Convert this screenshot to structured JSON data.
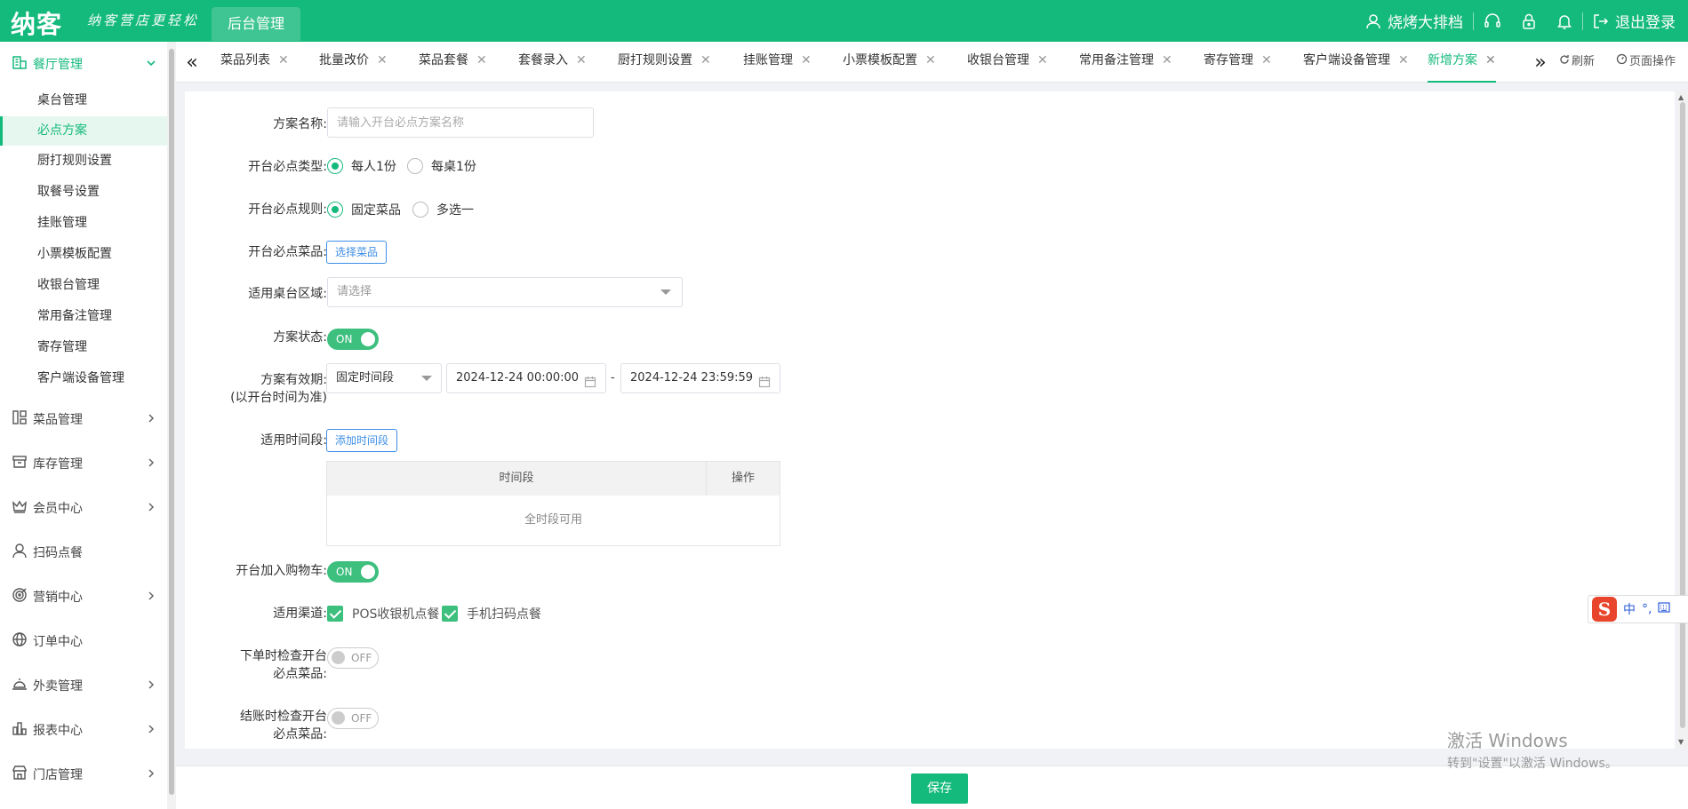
{
  "header": {
    "logo": "纳客",
    "slogan": "纳客营店更轻松",
    "nav_tab": "后台管理",
    "store_name": "烧烤大排档",
    "logout": "退出登录"
  },
  "sidebar": {
    "groups": [
      {
        "label": "餐厅管理",
        "icon": "restaurant-icon",
        "expanded": true
      },
      {
        "label": "菜品管理",
        "icon": "dish-icon"
      },
      {
        "label": "库存管理",
        "icon": "inventory-icon"
      },
      {
        "label": "会员中心",
        "icon": "crown-icon"
      },
      {
        "label": "扫码点餐",
        "icon": "user-icon"
      },
      {
        "label": "营销中心",
        "icon": "target-icon"
      },
      {
        "label": "订单中心",
        "icon": "globe-icon"
      },
      {
        "label": "外卖管理",
        "icon": "bell-service-icon"
      },
      {
        "label": "报表中心",
        "icon": "bar-chart-icon"
      },
      {
        "label": "门店管理",
        "icon": "store-icon"
      }
    ],
    "items": [
      "桌台管理",
      "必点方案",
      "厨打规则设置",
      "取餐号设置",
      "挂账管理",
      "小票模板配置",
      "收银台管理",
      "常用备注管理",
      "寄存管理",
      "客户端设备管理"
    ],
    "active_item": "必点方案"
  },
  "tabs": {
    "items": [
      "菜品列表",
      "批量改价",
      "菜品套餐",
      "套餐录入",
      "厨打规则设置",
      "挂账管理",
      "小票模板配置",
      "收银台管理",
      "常用备注管理",
      "寄存管理",
      "客户端设备管理",
      "新增方案"
    ],
    "active": "新增方案",
    "refresh": "刷新",
    "page_ops": "页面操作"
  },
  "form": {
    "name_label": "方案名称:",
    "name_placeholder": "请输入开台必点方案名称",
    "type_label": "开台必点类型:",
    "type_options": [
      "每人1份",
      "每桌1份"
    ],
    "rule_label": "开台必点规则:",
    "rule_options": [
      "固定菜品",
      "多选一"
    ],
    "dish_label": "开台必点菜品:",
    "select_dish_btn": "选择菜品",
    "area_label": "适用桌台区域:",
    "area_placeholder": "请选择",
    "status_label": "方案状态:",
    "status_value": "ON",
    "validity_label_1": "方案有效期:",
    "validity_label_2": "(以开台时间为准)",
    "validity_mode": "固定时间段",
    "start_time": "2024-12-24 00:00:00",
    "end_time": "2024-12-24 23:59:59",
    "date_sep": "-",
    "period_label": "适用时间段:",
    "add_period_btn": "添加时间段",
    "table_headers": [
      "时间段",
      "操作"
    ],
    "table_empty": "全时段可用",
    "cart_label": "开台加入购物车:",
    "cart_value": "ON",
    "channel_label": "适用渠道:",
    "channels": [
      "POS收银机点餐",
      "手机扫码点餐"
    ],
    "check_order_label_1": "下单时检查开台",
    "check_order_label_2": "必点菜品:",
    "check_order_value": "OFF",
    "check_pay_label_1": "结账时检查开台",
    "check_pay_label_2": "必点菜品:",
    "check_pay_value": "OFF"
  },
  "footer": {
    "save": "保存"
  },
  "ime": {
    "logo": "S",
    "mode": "中",
    "punct": "°,"
  },
  "watermark": {
    "line1": "激活 Windows",
    "line2": "转到\"设置\"以激活 Windows。"
  },
  "colors": {
    "brand": "#14b97c",
    "link": "#3d8ee6",
    "toggle_on": "#3dbf7e"
  }
}
